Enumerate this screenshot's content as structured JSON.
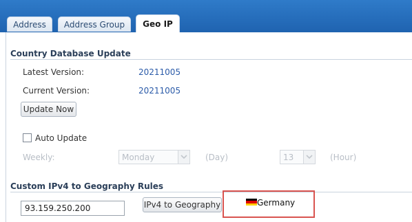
{
  "tabs": [
    {
      "label": "Address",
      "active": false
    },
    {
      "label": "Address Group",
      "active": false
    },
    {
      "label": "Geo IP",
      "active": true
    }
  ],
  "country_db": {
    "title": "Country Database Update",
    "latest_label": "Latest Version:",
    "latest_value": "20211005",
    "current_label": "Current Version:",
    "current_value": "20211005",
    "update_button": "Update Now",
    "auto_update_label": "Auto Update",
    "auto_update_checked": false,
    "weekly_label": "Weekly:",
    "day_select": "Monday",
    "day_unit": "(Day)",
    "hour_select": "13",
    "hour_unit": "(Hour)"
  },
  "custom_rules": {
    "title": "Custom IPv4 to Geography Rules",
    "ip_value": "93.159.250.200",
    "lookup_button": "IPv4 to Geography",
    "result_country": "Germany",
    "flag_colors": [
      "#000000",
      "#dd0000",
      "#ffce00"
    ]
  }
}
